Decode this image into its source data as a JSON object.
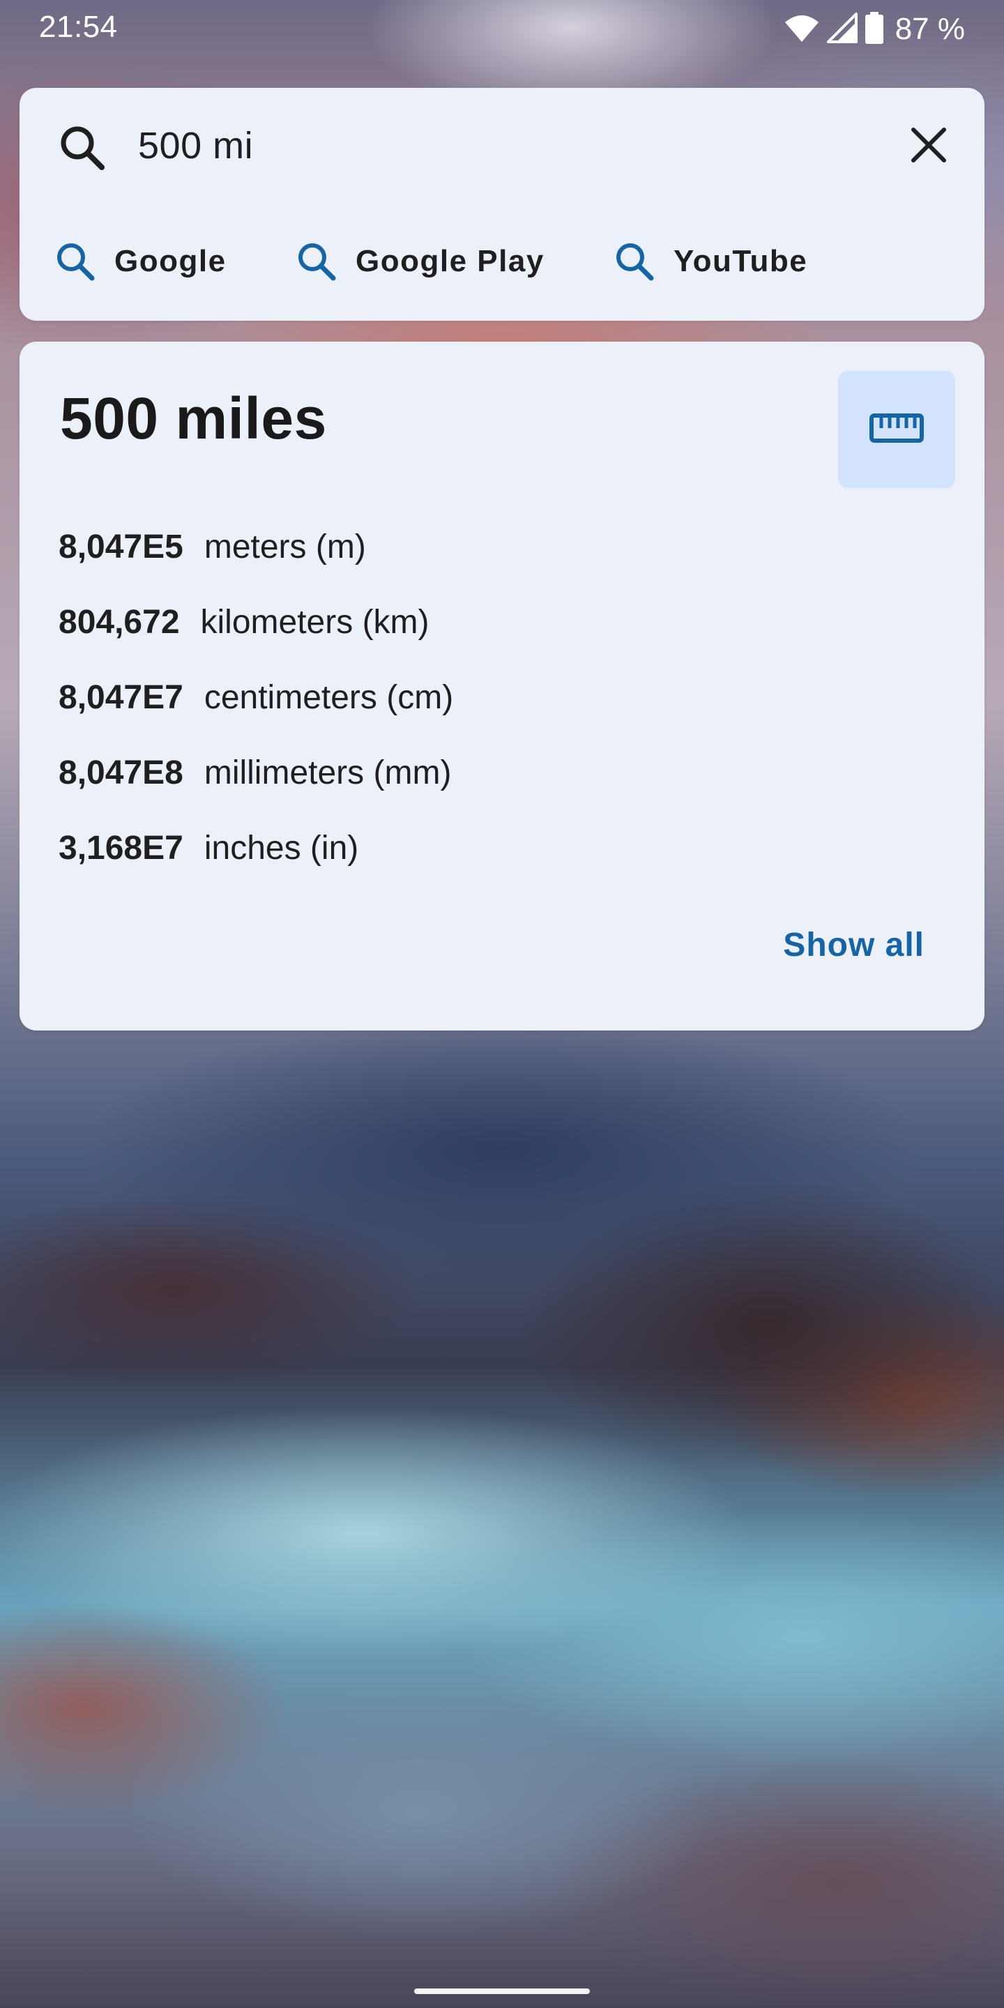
{
  "status_bar": {
    "time": "21:54",
    "battery_text": "87 %",
    "icons": [
      "wifi-icon",
      "cellular-signal-icon",
      "battery-icon"
    ]
  },
  "search": {
    "query": "500 mi",
    "icons": [
      "search-icon",
      "close-icon"
    ],
    "providers": [
      {
        "label": "Google",
        "icon": "search-icon"
      },
      {
        "label": "Google Play",
        "icon": "search-icon"
      },
      {
        "label": "YouTube",
        "icon": "search-icon"
      }
    ]
  },
  "conversion": {
    "title": "500 miles",
    "icon": "ruler-icon",
    "rows": [
      {
        "value": "8,047E5",
        "unit": "meters (m)"
      },
      {
        "value": "804,672",
        "unit": "kilometers (km)"
      },
      {
        "value": "8,047E7",
        "unit": "centimeters (cm)"
      },
      {
        "value": "8,047E8",
        "unit": "millimeters (mm)"
      },
      {
        "value": "3,168E7",
        "unit": "inches (in)"
      }
    ],
    "show_all_label": "Show all"
  },
  "colors": {
    "card_background": "#ecf0f9",
    "accent": "#1565a6",
    "ruler_button_background": "#d3e3fd"
  }
}
